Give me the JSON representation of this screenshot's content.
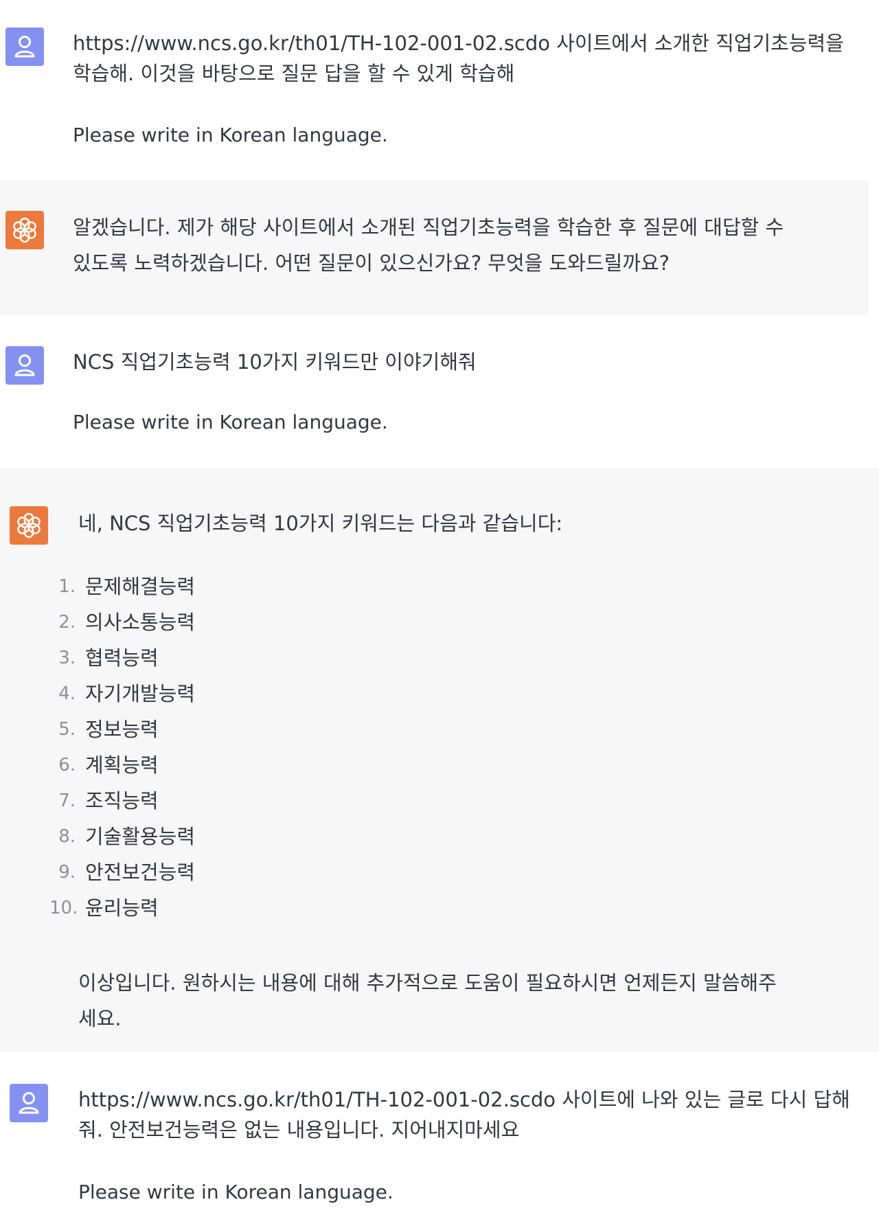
{
  "conversation": {
    "messages": [
      {
        "role": "user",
        "avatar_icon": "user-icon",
        "lines": [
          "https://www.ncs.go.kr/th01/TH-102-001-02.scdo 사이트에서 소개한 직업기초능력을",
          "학습해. 이것을 바탕으로 질문 답을 할 수 있게 학습해"
        ],
        "note": "Please write in Korean language."
      },
      {
        "role": "assistant",
        "avatar_icon": "openai-logo-icon",
        "lines": [
          "알겠습니다. 제가 해당 사이트에서 소개된 직업기초능력을 학습한 후 질문에 대답할 수",
          "있도록 노력하겠습니다. 어떤 질문이 있으신가요? 무엇을 도와드릴까요?"
        ]
      },
      {
        "role": "user",
        "avatar_icon": "user-icon",
        "lines": [
          "NCS 직업기초능력 10가지 키워드만 이야기해줘"
        ],
        "note": "Please write in Korean language."
      },
      {
        "role": "assistant",
        "avatar_icon": "openai-logo-icon",
        "intro": "네, NCS 직업기초능력 10가지 키워드는 다음과 같습니다:",
        "list": [
          {
            "num": "1.",
            "label": "문제해결능력"
          },
          {
            "num": "2.",
            "label": "의사소통능력"
          },
          {
            "num": "3.",
            "label": "협력능력"
          },
          {
            "num": "4.",
            "label": "자기개발능력"
          },
          {
            "num": "5.",
            "label": "정보능력"
          },
          {
            "num": "6.",
            "label": "계획능력"
          },
          {
            "num": "7.",
            "label": "조직능력"
          },
          {
            "num": "8.",
            "label": "기술활용능력"
          },
          {
            "num": "9.",
            "label": "안전보건능력"
          },
          {
            "num": "10.",
            "label": "윤리능력"
          }
        ],
        "outro": [
          "이상입니다. 원하시는 내용에 대해 추가적으로 도움이 필요하시면 언제든지 말씀해주",
          "세요."
        ]
      },
      {
        "role": "user",
        "avatar_icon": "user-icon",
        "lines": [
          "https://www.ncs.go.kr/th01/TH-102-001-02.scdo 사이트에 나와 있는 글로 다시 답해",
          "줘. 안전보건능력은 없는 내용입니다. 지어내지마세요"
        ],
        "note": "Please write in Korean language."
      }
    ]
  },
  "colors": {
    "user_avatar": "#8591f2",
    "assistant_avatar": "#ec7a3d",
    "assistant_background": "#f7f7f8",
    "text": "#353740"
  }
}
